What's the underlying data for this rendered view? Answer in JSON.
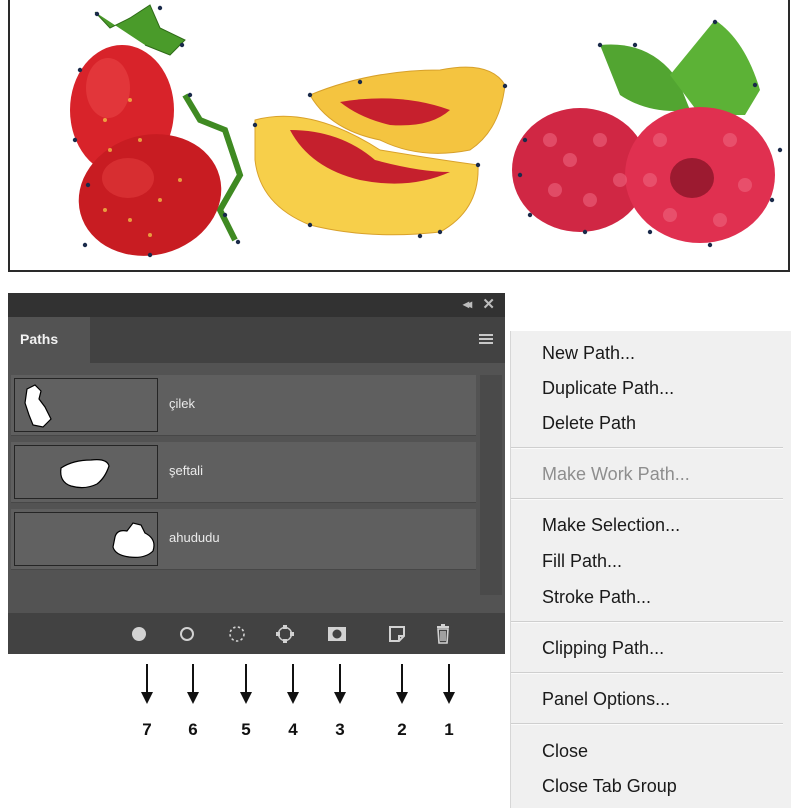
{
  "panel": {
    "tab_label": "Paths",
    "paths": [
      {
        "name": "çilek"
      },
      {
        "name": "şeftali"
      },
      {
        "name": "ahududu"
      }
    ]
  },
  "toolbar_icons": [
    "fill-path-icon",
    "stroke-path-icon",
    "load-path-as-selection-icon",
    "make-work-path-icon",
    "add-mask-icon",
    "create-new-path-icon",
    "delete-path-icon"
  ],
  "callouts": [
    "7",
    "6",
    "5",
    "4",
    "3",
    "2",
    "1"
  ],
  "flyout_menu": {
    "new_path": "New Path...",
    "duplicate_path": "Duplicate Path...",
    "delete_path": "Delete Path",
    "make_work_path": "Make Work Path...",
    "make_selection": "Make Selection...",
    "fill_path": "Fill Path...",
    "stroke_path": "Stroke Path...",
    "clipping_path": "Clipping Path...",
    "panel_options": "Panel Options...",
    "close": "Close",
    "close_tab_group": "Close Tab Group"
  },
  "colors": {
    "panel_bg": "#535353",
    "panel_dark": "#424242",
    "titlebar": "#323232",
    "menu_bg": "#f0f0f0",
    "strawberry": "#d8232a",
    "peach": "#f6c23a",
    "raspberry": "#d8294a",
    "leaf": "#4a9b2a"
  }
}
